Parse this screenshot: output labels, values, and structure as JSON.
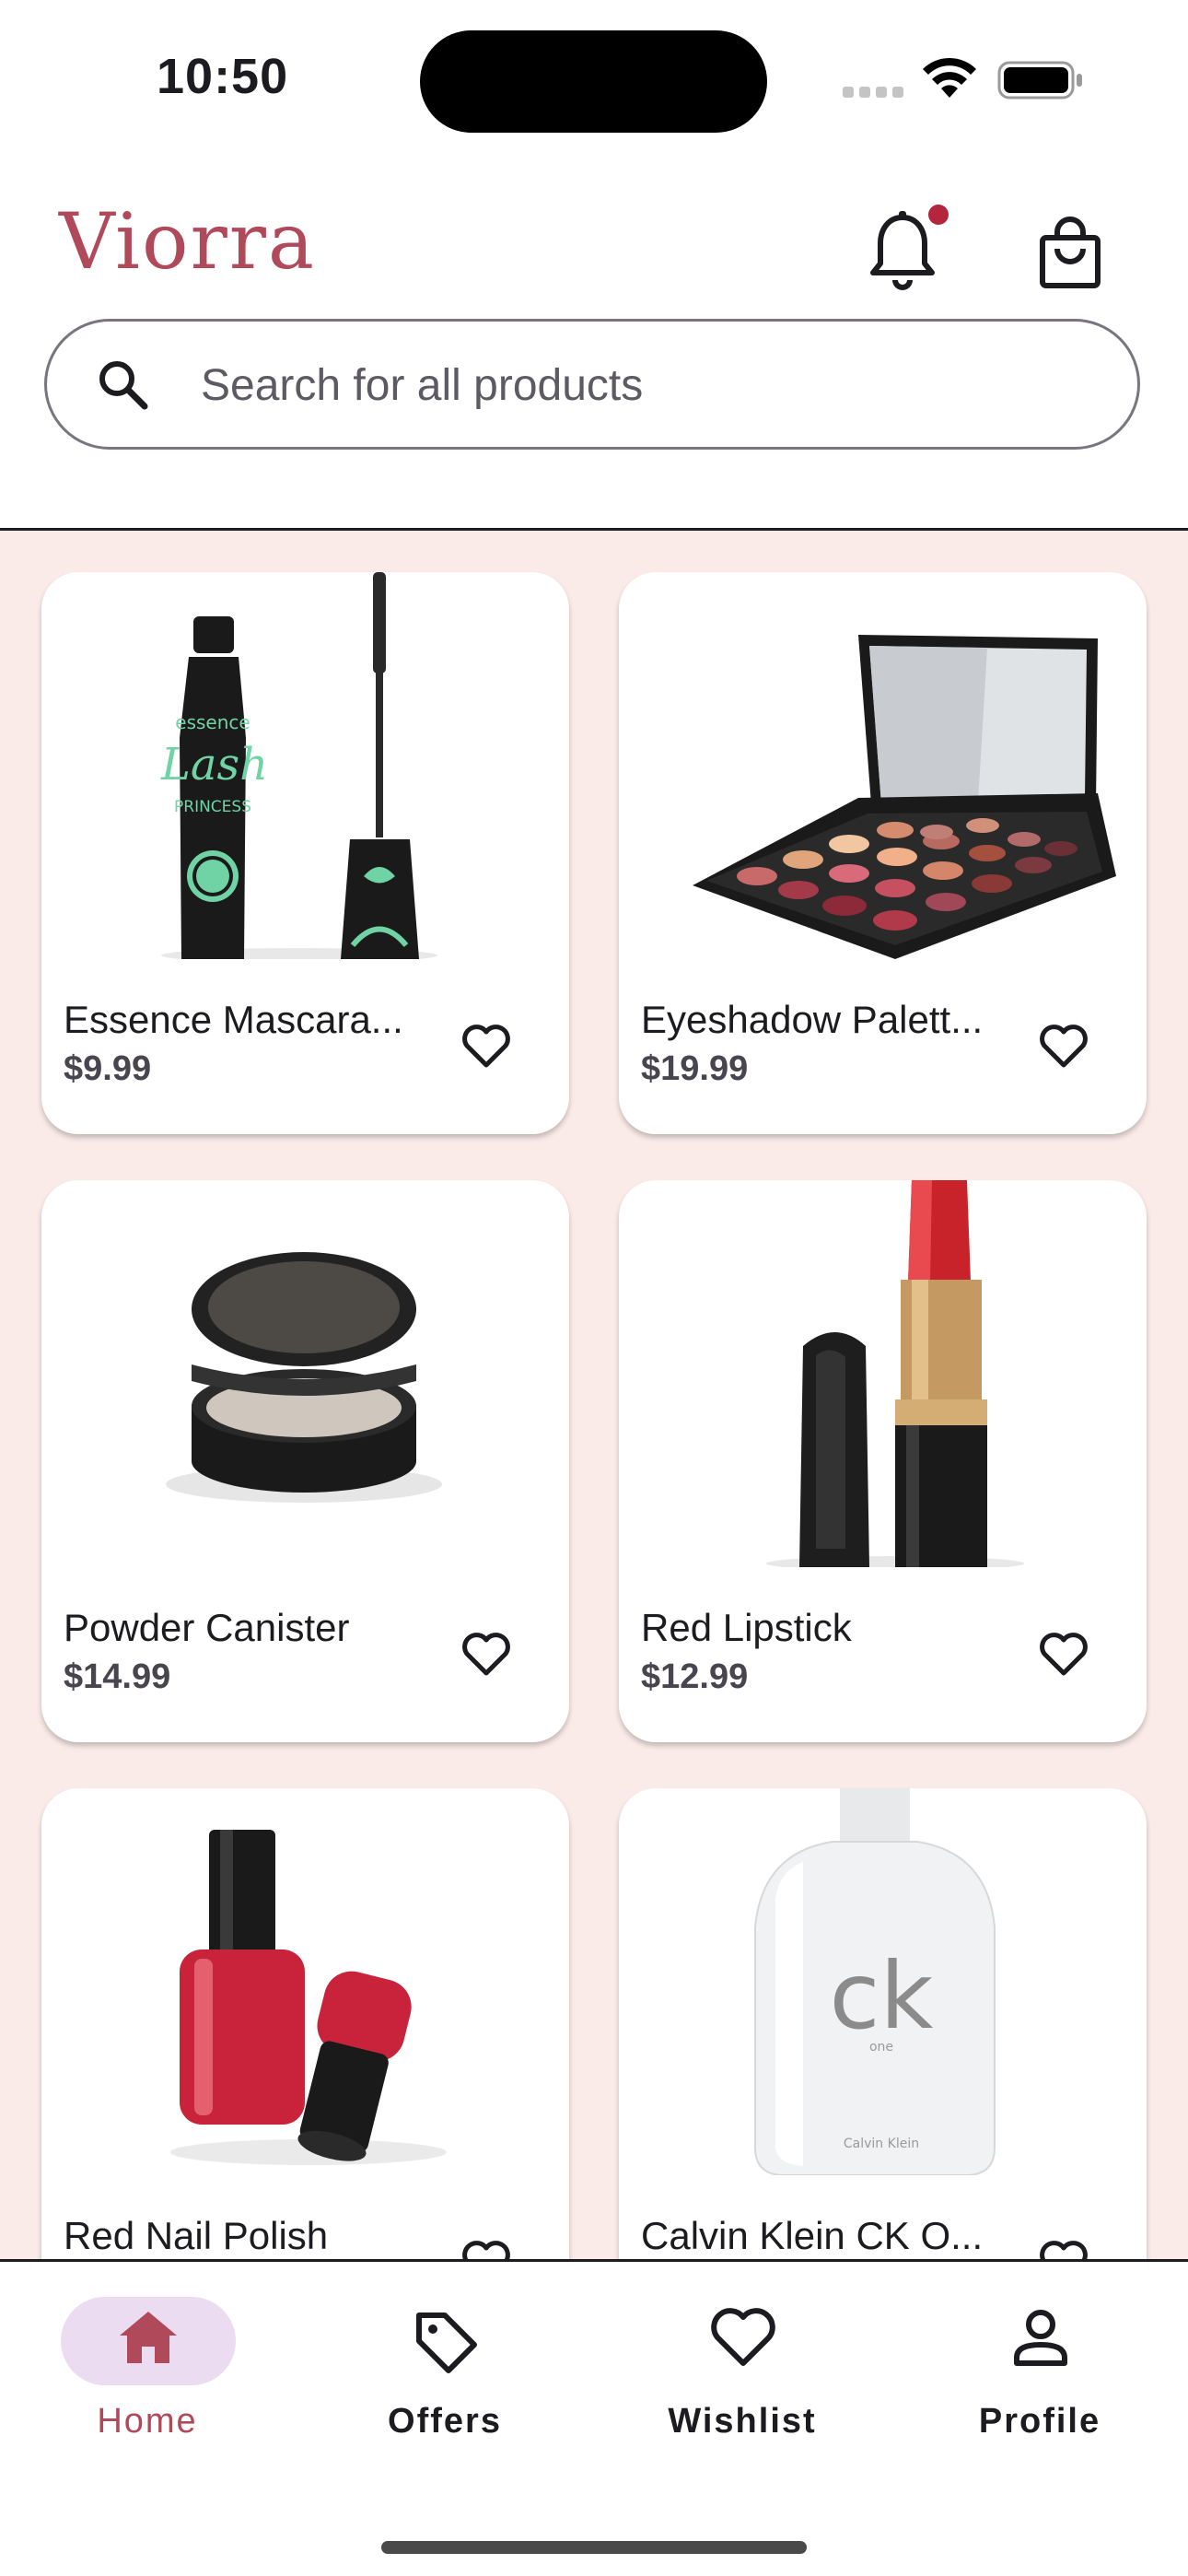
{
  "status_bar": {
    "time": "10:50"
  },
  "header": {
    "brand": "Viorra",
    "notification_icon": "bell-icon",
    "cart_icon": "shopping-bag-icon",
    "has_notification": true
  },
  "search": {
    "placeholder": "Search for all products",
    "value": ""
  },
  "products": [
    {
      "name": "Essence Mascara...",
      "price": "$9.99",
      "image": "mascara"
    },
    {
      "name": "Eyeshadow Palett...",
      "price": "$19.99",
      "image": "eyeshadow-palette"
    },
    {
      "name": "Powder Canister",
      "price": "$14.99",
      "image": "powder-compact"
    },
    {
      "name": "Red Lipstick",
      "price": "$12.99",
      "image": "lipstick"
    },
    {
      "name": "Red Nail Polish",
      "price": "",
      "image": "nail-polish"
    },
    {
      "name": "Calvin Klein CK O...",
      "price": "",
      "image": "perfume-bottle"
    }
  ],
  "product_image_text": {
    "mascara_brand": "essence",
    "mascara_line": "Lash",
    "mascara_sub": "PRINCESS",
    "perfume_logo": "ck",
    "perfume_sub": "one",
    "perfume_maker": "Calvin Klein"
  },
  "bottom_nav": [
    {
      "label": "Home",
      "icon": "home-icon",
      "active": true
    },
    {
      "label": "Offers",
      "icon": "tag-icon",
      "active": false
    },
    {
      "label": "Wishlist",
      "icon": "heart-icon",
      "active": false
    },
    {
      "label": "Profile",
      "icon": "person-icon",
      "active": false
    }
  ],
  "colors": {
    "accent": "#b04a5a",
    "background": "#fbebe8",
    "active_pill": "#ecdcf2",
    "notification": "#b3263e"
  }
}
